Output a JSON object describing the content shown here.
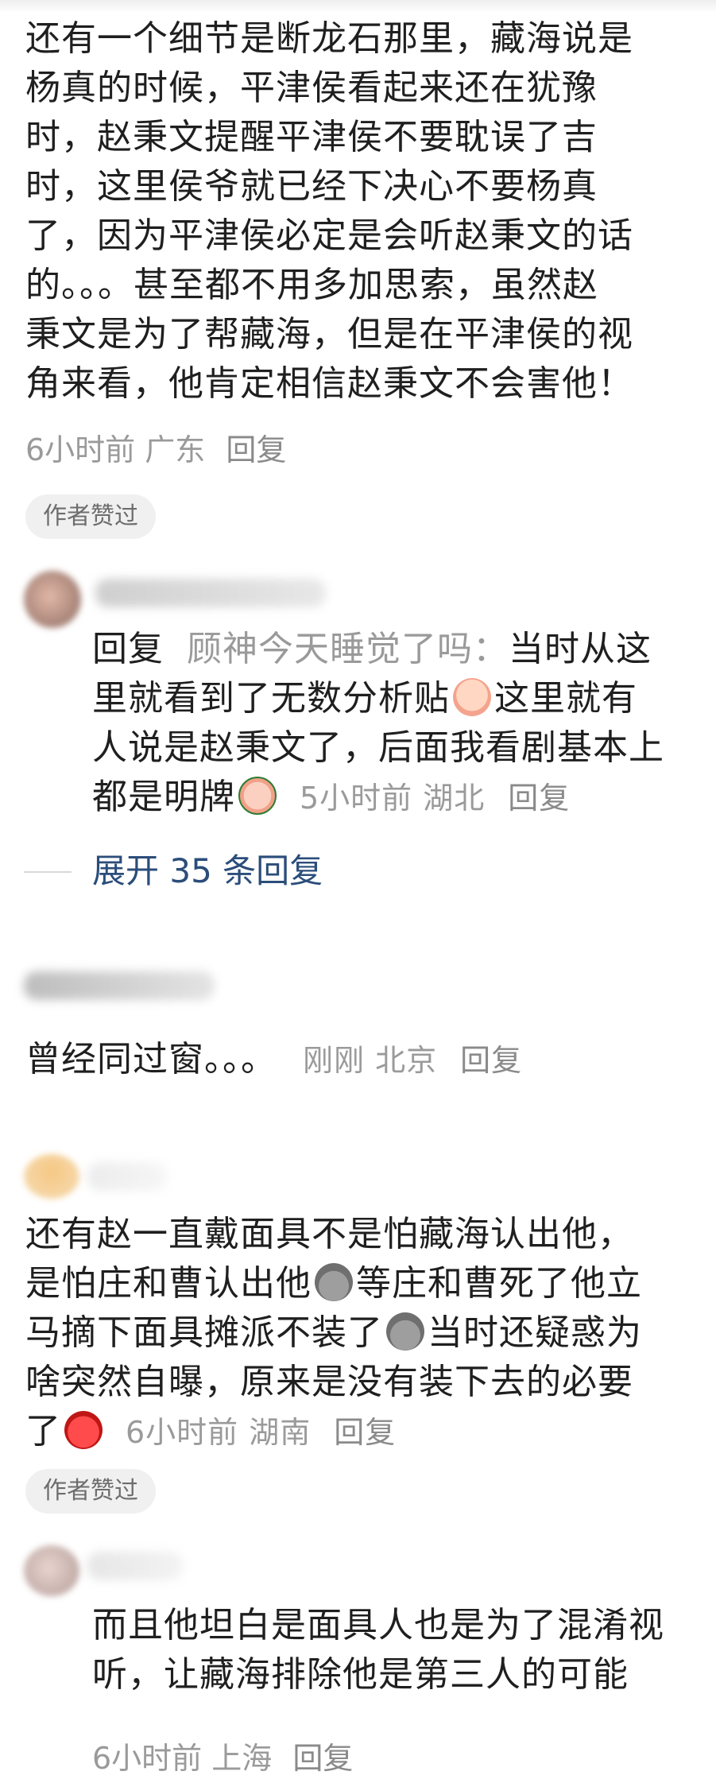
{
  "comment1": {
    "lines": [
      "还有一个细节是断龙石那里，藏海说是",
      "杨真的时候，平津侯看起来还在犹豫",
      "时，赵秉文提醒平津侯不要耽误了吉",
      "时，这里侯爷就已经下决心不要杨真",
      "了，因为平津侯必定是会听赵秉文的话",
      "的。。。甚至都不用多加思索，虽然赵",
      "秉文是为了帮藏海，但是在平津侯的视",
      "角来看，他肯定相信赵秉文不会害他！"
    ],
    "time_location": "6小时前 广东",
    "reply_label": "回复",
    "author_liked": "作者赞过"
  },
  "reply1": {
    "prefix": "回复",
    "mention": "顾神今天睡觉了吗：",
    "line1_text": "当时从这",
    "line2_text": "里就看到了无数分析贴",
    "line2_after": "这里就有",
    "line3_text": "人说是赵秉文了，后面我看剧基本上",
    "line4_text": "都是明牌",
    "time_location": "5小时前 湖北",
    "reply_label": "回复",
    "emoji1": "cry-face-icon",
    "emoji2": "sad-face-icon"
  },
  "expand": {
    "label": "展开 35 条回复"
  },
  "comment2": {
    "text": "曾经同过窗。。。",
    "time_location": "刚刚 北京",
    "reply_label": "回复"
  },
  "comment3": {
    "line1": "还有赵一直戴面具不是怕藏海认出他，",
    "line2_a": "是怕庄和曹认出他",
    "line2_b": "等庄和曹死了他立",
    "line3_a": "马摘下面具摊派不装了",
    "line3_b": "当时还疑惑为",
    "line4": "啥突然自曝，原来是没有装下去的必要",
    "line5": "了",
    "time_location": "6小时前 湖南",
    "reply_label": "回复",
    "author_liked": "作者赞过"
  },
  "reply2": {
    "line1": "而且他坦白是面具人也是为了混淆视",
    "line2": "听，让藏海排除他是第三人的可能",
    "time_location": "6小时前 上海",
    "reply_label": "回复"
  }
}
